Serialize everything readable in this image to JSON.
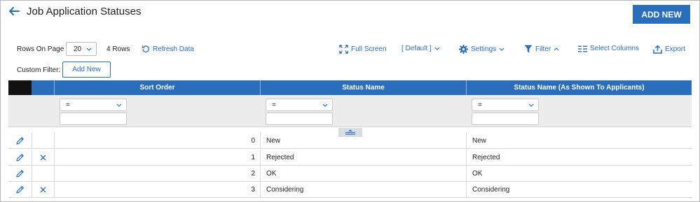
{
  "header": {
    "title": "Job Application Statuses",
    "add_new_label": "ADD NEW"
  },
  "toolbar": {
    "rows_on_page_label": "Rows On Page",
    "rows_on_page_value": "20",
    "row_count_label": "4 Rows",
    "refresh_label": "Refresh Data",
    "full_screen_label": "Full Screen",
    "view_label": "[ Default ]",
    "settings_label": "Settings",
    "filter_label": "Filter",
    "select_columns_label": "Select Columns",
    "export_label": "Export"
  },
  "custom_filter": {
    "label": "Custom Filter:",
    "add_new_label": "Add New"
  },
  "table": {
    "columns": [
      "Sort Order",
      "Status Name",
      "Status Name (As Shown To Applicants)"
    ],
    "filters": [
      {
        "operator": "=",
        "value": ""
      },
      {
        "operator": "=",
        "value": ""
      },
      {
        "operator": "=",
        "value": ""
      }
    ],
    "rows": [
      {
        "sort_order": "0",
        "status_name": "New",
        "shown_name": "New",
        "deletable": false
      },
      {
        "sort_order": "1",
        "status_name": "Rejected",
        "shown_name": "Rejected",
        "deletable": true
      },
      {
        "sort_order": "2",
        "status_name": "OK",
        "shown_name": "OK",
        "deletable": false
      },
      {
        "sort_order": "3",
        "status_name": "Considering",
        "shown_name": "Considering",
        "deletable": true
      }
    ]
  },
  "icons": {
    "back": "arrow-left-icon",
    "refresh": "refresh-icon",
    "full_screen": "expand-icon",
    "settings": "gear-icon",
    "filter": "funnel-icon",
    "select_columns": "columns-icon",
    "export": "upload-icon",
    "edit": "pencil-icon",
    "delete": "close-icon"
  },
  "colors": {
    "accent": "#2a6ebb",
    "header_bg": "#2a6ebb",
    "filter_bg": "#ececec"
  }
}
